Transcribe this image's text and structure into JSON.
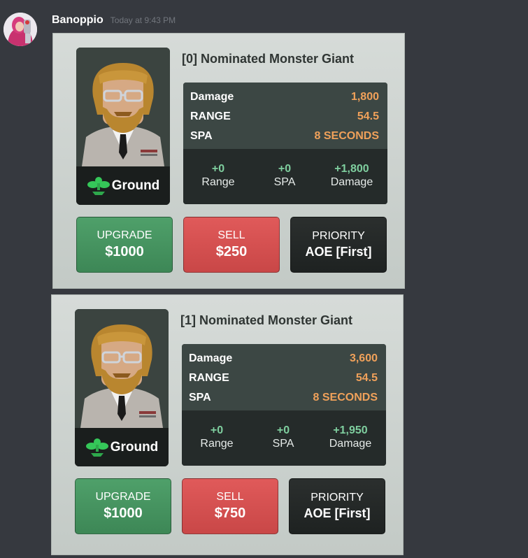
{
  "message": {
    "username": "Banoppio",
    "timestamp": "Today at 9:43 PM"
  },
  "cards": [
    {
      "title": "[0] Nominated Monster Giant",
      "placement": "Ground",
      "stats": {
        "damage_label": "Damage",
        "damage_value": "1,800",
        "range_label": "RANGE",
        "range_value": "54.5",
        "spa_label": "SPA",
        "spa_value": "8 SECONDS"
      },
      "boosts": {
        "range_value": "+0",
        "range_label": "Range",
        "spa_value": "+0",
        "spa_label": "SPA",
        "damage_value": "+1,800",
        "damage_label": "Damage"
      },
      "upgrade": {
        "label": "UPGRADE",
        "value": "$1000"
      },
      "sell": {
        "label": "SELL",
        "value": "$250"
      },
      "priority": {
        "label": "PRIORITY",
        "value": "AOE [First]"
      }
    },
    {
      "title": "[1] Nominated Monster Giant",
      "placement": "Ground",
      "stats": {
        "damage_label": "Damage",
        "damage_value": "3,600",
        "range_label": "RANGE",
        "range_value": "54.5",
        "spa_label": "SPA",
        "spa_value": "8 SECONDS"
      },
      "boosts": {
        "range_value": "+0",
        "range_label": "Range",
        "spa_value": "+0",
        "spa_label": "SPA",
        "damage_value": "+1,950",
        "damage_label": "Damage"
      },
      "upgrade": {
        "label": "UPGRADE",
        "value": "$1000"
      },
      "sell": {
        "label": "SELL",
        "value": "$750"
      },
      "priority": {
        "label": "PRIORITY",
        "value": "AOE [First]"
      }
    }
  ],
  "colors": {
    "background": "#36393f",
    "stat_value": "#f0a15a",
    "boost_value": "#7fcf9f",
    "upgrade": "#4fa06a",
    "sell": "#e05a5a",
    "priority": "#1e2221"
  },
  "icons": {
    "avatar": "user-avatar-icon",
    "portrait": "unit-portrait-icon",
    "placement": "ground-plant-icon"
  }
}
